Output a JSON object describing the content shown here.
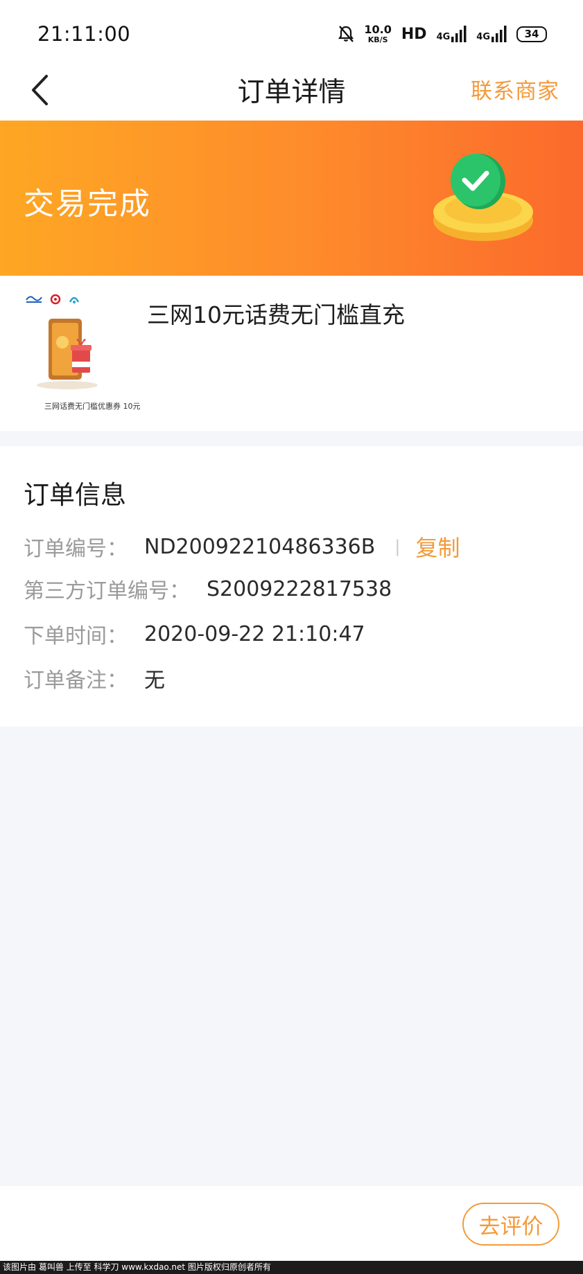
{
  "status_bar": {
    "time": "21:11:00",
    "net_speed_value": "10.0",
    "net_speed_unit": "KB/S",
    "hd_label": "HD",
    "sim1_label": "4G",
    "sim2_label": "4G",
    "battery": "34",
    "icons": [
      "bell-off-icon",
      "signal-icon",
      "signal-icon"
    ]
  },
  "nav": {
    "title": "订单详情",
    "back_icon": "chevron-left-icon",
    "contact_label": "联系商家"
  },
  "banner": {
    "status_text": "交易完成",
    "badge_icon": "check-coin-icon"
  },
  "product": {
    "title": "三网10元话费无门槛直充",
    "thumb_caption": "三网话费无门槛优惠券 10元"
  },
  "order_info": {
    "heading": "订单信息",
    "rows": [
      {
        "label": "订单编号：",
        "value": "ND20092210486336B"
      },
      {
        "label": "第三方订单编号：",
        "value": "S2009222817538"
      },
      {
        "label": "下单时间：",
        "value": "2020-09-22 21:10:47"
      },
      {
        "label": "订单备注：",
        "value": "无"
      }
    ],
    "divider": "|",
    "copy_label": "复制"
  },
  "footer": {
    "review_label": "去评价"
  },
  "watermark": "该图片由 葛叫兽 上传至 科学刀 www.kxdao.net 图片版权归原创者所有",
  "colors": {
    "accent": "#f39a3b",
    "banner_start": "#fea724",
    "banner_end": "#fb6a2c",
    "background": "#f5f6fa"
  }
}
